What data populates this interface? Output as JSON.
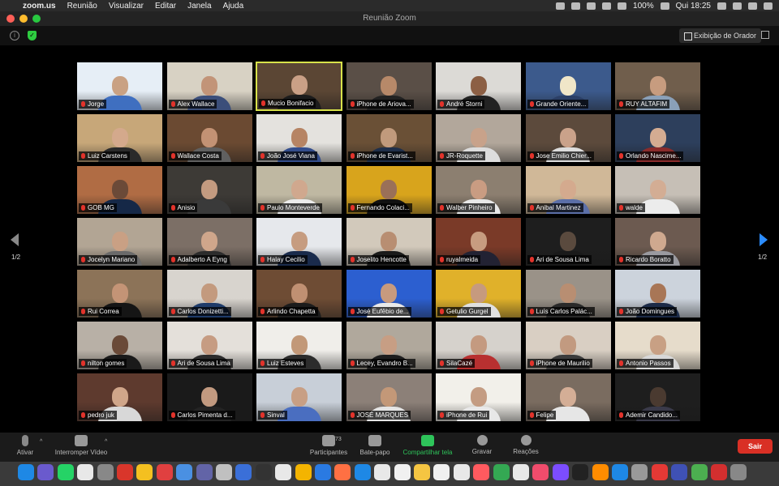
{
  "menubar": {
    "app": "zoom.us",
    "items": [
      "Reunião",
      "Visualizar",
      "Editar",
      "Janela",
      "Ajuda"
    ],
    "battery": "100%",
    "clock": "Qui 18:25"
  },
  "window": {
    "title": "Reunião Zoom"
  },
  "meeting": {
    "view_button": "Exibição de Orador"
  },
  "pager": {
    "left": "1/2",
    "right": "1/2"
  },
  "participants": [
    {
      "name": "Jorge",
      "bg": "#e6eef6",
      "skin": "#c9a183",
      "shirt": "#3f6fc0"
    },
    {
      "name": "Alex Wallace",
      "bg": "#d8d2c4",
      "skin": "#c29478",
      "shirt": "#3b4e7a"
    },
    {
      "name": "Mucio Bonifacio",
      "bg": "#5b4634",
      "skin": "#caa086",
      "shirt": "#1c1c1c",
      "active": true
    },
    {
      "name": "iPhone de Ariova...",
      "bg": "#5a4f47",
      "skin": "#b78969",
      "shirt": "#222"
    },
    {
      "name": "André Storni",
      "bg": "#dcdad6",
      "skin": "#8c5f44",
      "shirt": "#222"
    },
    {
      "name": "Grande Oriente...",
      "bg": "#3c5a8c",
      "skin": "#f0e6c8",
      "shirt": "#2b3f66"
    },
    {
      "name": "RUY ALTAFIM",
      "bg": "#705e4c",
      "skin": "#c79c7f",
      "shirt": "#8aa0b8"
    },
    {
      "name": "Luiz Carstens",
      "bg": "#c7a779",
      "skin": "#d4a98c",
      "shirt": "#2a2a2a"
    },
    {
      "name": "Wallace Costa",
      "bg": "#6b4a32",
      "skin": "#c39274",
      "shirt": "#606060"
    },
    {
      "name": "João José Viana",
      "bg": "#e4e2de",
      "skin": "#b68464",
      "shirt": "#334d8c"
    },
    {
      "name": "iPhone de Evarist...",
      "bg": "#6a5036",
      "skin": "#c19a7c",
      "shirt": "#1f2f4a"
    },
    {
      "name": "JR-Roquette",
      "bg": "#b2a79b",
      "skin": "#c8a28a",
      "shirt": "#ddd"
    },
    {
      "name": "Jose Emilio Chier...",
      "bg": "#5c4a3c",
      "skin": "#caa28a",
      "shirt": "#ddd"
    },
    {
      "name": "Orlando Nascime...",
      "bg": "#2d3f5c",
      "skin": "#d4ac92",
      "shirt": "#8a2b2b"
    },
    {
      "name": "GOB MG",
      "bg": "#b06c44",
      "skin": "#6b4a38",
      "shirt": "#152847"
    },
    {
      "name": "Anisio",
      "bg": "#3d3a36",
      "skin": "#c49b80",
      "shirt": "#3a3a3a"
    },
    {
      "name": "Paulo Monteverde",
      "bg": "#bfb8a2",
      "skin": "#d0a88e",
      "shirt": "#ececec"
    },
    {
      "name": "Fernando Colaci...",
      "bg": "#d8a41c",
      "skin": "#9a7058",
      "shirt": "#111"
    },
    {
      "name": "Walber Pinheiro",
      "bg": "#8c7f70",
      "skin": "#c99c82",
      "shirt": "#e8e8e8"
    },
    {
      "name": "Anibal Martinez",
      "bg": "#d0b898",
      "skin": "#d4aa8e",
      "shirt": "#5b6fa8"
    },
    {
      "name": "walde",
      "bg": "#c6bfb6",
      "skin": "#d3ad94",
      "shirt": "#ececec"
    },
    {
      "name": "Jocelyn Mariano",
      "bg": "#b2a594",
      "skin": "#c9a084",
      "shirt": "#6a6a6a"
    },
    {
      "name": "Adalberto A Eyng",
      "bg": "#7c6f66",
      "skin": "#cfa68b",
      "shirt": "#2c2c2c"
    },
    {
      "name": "Halay Cecilio",
      "bg": "#e6e8ec",
      "skin": "#c69c80",
      "shirt": "#1a2b4c"
    },
    {
      "name": "Joselito Hencotte",
      "bg": "#d2c9bb",
      "skin": "#b88e72",
      "shirt": "#1a1a1a"
    },
    {
      "name": "ruyalmeida",
      "bg": "#7a3a28",
      "skin": "#c79c80",
      "shirt": "#223"
    },
    {
      "name": "Ari de Sousa Lima",
      "bg": "#1e1e1e",
      "skin": "#5a4a3e",
      "shirt": "#1a1a1a"
    },
    {
      "name": "Ricardo Boratto",
      "bg": "#6c5a50",
      "skin": "#cfa98f",
      "shirt": "#9a9aa0"
    },
    {
      "name": "Rui Correa",
      "bg": "#8c7358",
      "skin": "#c49476",
      "shirt": "#151515"
    },
    {
      "name": "Carlos Donizetti...",
      "bg": "#d8d4ce",
      "skin": "#c39a7e",
      "shirt": "#1e3b6a"
    },
    {
      "name": "Arlindo Chapetta",
      "bg": "#6e4c34",
      "skin": "#c09072",
      "shirt": "#1c1c1c"
    },
    {
      "name": "José Eufêbio de...",
      "bg": "#2c5fd0",
      "skin": "#c79a7e",
      "shirt": "#e9e9e9"
    },
    {
      "name": "Getulio Gurgel",
      "bg": "#e0b12a",
      "skin": "#c69a7e",
      "shirt": "#e0e0e0"
    },
    {
      "name": "Luís Carlos Palác...",
      "bg": "#9a9288",
      "skin": "#b88e72",
      "shirt": "#2a2a2a"
    },
    {
      "name": "João Domingues",
      "bg": "#ccd3dc",
      "skin": "#a87656",
      "shirt": "#1c2b48"
    },
    {
      "name": "nilton gomes",
      "bg": "#b8b0a6",
      "skin": "#6a4a38",
      "shirt": "#1a1a1a"
    },
    {
      "name": "Ari de Sousa Lima",
      "bg": "#e4e0da",
      "skin": "#c69c82",
      "shirt": "#2c2c2c"
    },
    {
      "name": "Luiz Esteves",
      "bg": "#f0eeea",
      "skin": "#c29878",
      "shirt": "#2c2c2c"
    },
    {
      "name": "Lecey, Evandro B...",
      "bg": "#b0a89c",
      "skin": "#c79e84",
      "shirt": "#1e1e1e"
    },
    {
      "name": "SilaCazé",
      "bg": "#d6d2cc",
      "skin": "#c49a80",
      "shirt": "#b83030"
    },
    {
      "name": "iPhone de Maurilio",
      "bg": "#d9cfc3",
      "skin": "#c29a80",
      "shirt": "#3c3c3c"
    },
    {
      "name": "Antonio Passos",
      "bg": "#e6dccb",
      "skin": "#c8a084",
      "shirt": "#d8d8d8"
    },
    {
      "name": "pedro juk",
      "bg": "#5e3a2e",
      "skin": "#d0a68a",
      "shirt": "#d8d8d8"
    },
    {
      "name": "Carlos Pimenta d...",
      "bg": "#1a1a1a",
      "skin": "#c29a80",
      "shirt": "#242424"
    },
    {
      "name": "Sinval",
      "bg": "#c8cfd8",
      "skin": "#c89f84",
      "shirt": "#4a6ec0"
    },
    {
      "name": "JOSÉ MARQUES",
      "bg": "#8c8078",
      "skin": "#c39878",
      "shirt": "#e4e4e4"
    },
    {
      "name": "iPhone de Rui",
      "bg": "#f2f0ea",
      "skin": "#c49c82",
      "shirt": "#e8e8e8"
    },
    {
      "name": "Felipe",
      "bg": "#7a6c60",
      "skin": "#d4ae96",
      "shirt": "#e6e6e6"
    },
    {
      "name": "Ademir Candido...",
      "bg": "#1e1e1e",
      "skin": "#4a3a30",
      "shirt": "#3a3a4a"
    }
  ],
  "toolbar": {
    "mute": "Ativar",
    "video": "Interromper Vídeo",
    "participants": "Participantes",
    "participants_count": "73",
    "chat": "Bate-papo",
    "share": "Compartilhar tela",
    "record": "Gravar",
    "reactions": "Reações",
    "leave": "Sair"
  },
  "dock_colors": [
    "#1e88e5",
    "#6a5acd",
    "#25d366",
    "#e8e8e8",
    "#888",
    "#d9362b",
    "#f4c020",
    "#e04040",
    "#4a90e2",
    "#6264a7",
    "#c0c0c0",
    "#3a6fd8",
    "#333",
    "#e8e8e8",
    "#f4b400",
    "#2a7ae2",
    "#ff7043",
    "#1e88e5",
    "#e8e8e8",
    "#f0f0f0",
    "#f5c542",
    "#f0f0f0",
    "#e8e8e8",
    "#ff5a5f",
    "#34a853",
    "#e8e8e8",
    "#f04c6c",
    "#7c4dff",
    "#222",
    "#ff8c00",
    "#1e88e5",
    "#999",
    "#e53935",
    "#3f51b5",
    "#4caf50",
    "#d32f2f",
    "#888"
  ]
}
